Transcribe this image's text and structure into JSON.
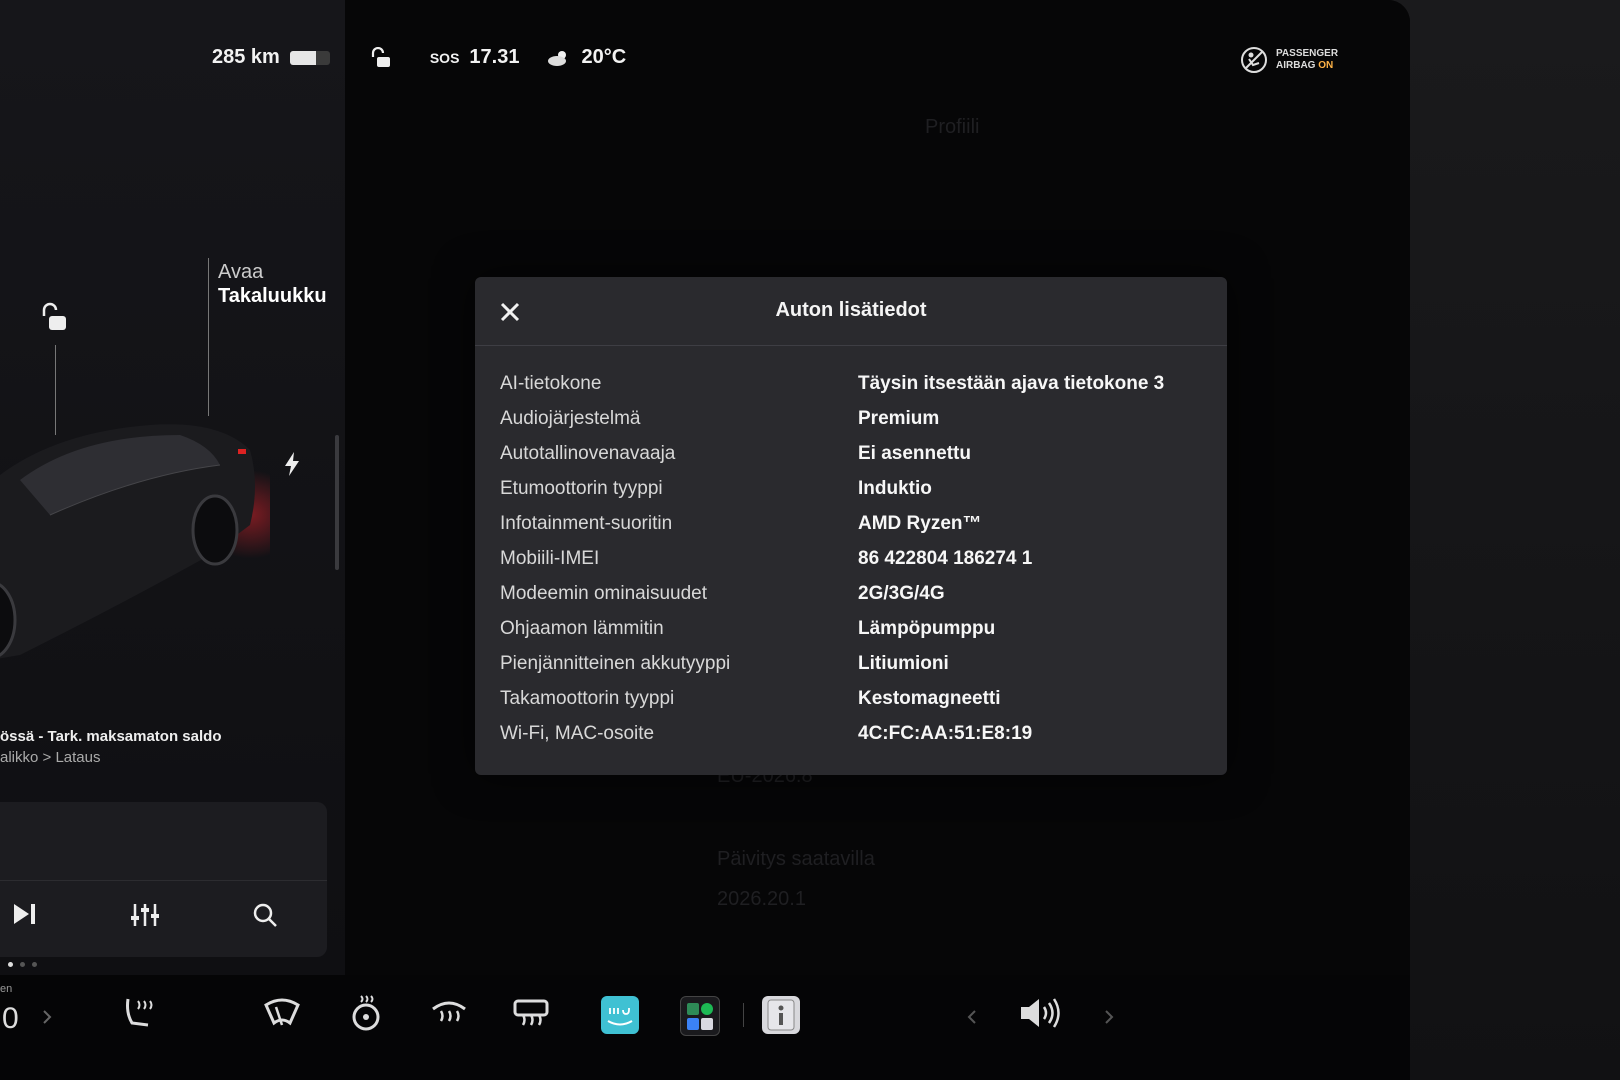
{
  "status": {
    "range": "285 km",
    "battery_level": 0.65,
    "sos": "SOS",
    "time": "17.31",
    "outside_temp": "20°C",
    "airbag_line1": "PASSENGER",
    "airbag_line2": "AIRBAG",
    "airbag_state": "ON"
  },
  "car": {
    "trunk_action": "Avaa",
    "trunk_label": "Takaluukku",
    "notice_line1": "össä - Tark. maksamaton saldo",
    "notice_line2": "alikko > Lataus"
  },
  "background": {
    "profile": "Profiili",
    "version": "EU-2026.8",
    "update_label": "Päivitys saatavilla",
    "update_version": "2026.20.1"
  },
  "bottom_bar": {
    "temp_left": "0",
    "temp_side_label": "en"
  },
  "modal": {
    "title": "Auton lisätiedot",
    "rows": [
      {
        "label": "AI-tietokone",
        "value": "Täysin itsestään ajava tietokone 3"
      },
      {
        "label": "Audiojärjestelmä",
        "value": "Premium"
      },
      {
        "label": "Autotallinovenavaaja",
        "value": "Ei asennettu"
      },
      {
        "label": "Etumoottorin tyyppi",
        "value": "Induktio"
      },
      {
        "label": "Infotainment-suoritin",
        "value": "AMD Ryzen™"
      },
      {
        "label": "Mobiili-IMEI",
        "value": "86 422804 186274 1"
      },
      {
        "label": "Modeemin ominaisuudet",
        "value": "2G/3G/4G"
      },
      {
        "label": "Ohjaamon lämmitin",
        "value": "Lämpöpumppu"
      },
      {
        "label": "Pienjännitteinen akkutyyppi",
        "value": "Litiumioni"
      },
      {
        "label": "Takamoottorin tyyppi",
        "value": "Kestomagneetti"
      },
      {
        "label": "Wi-Fi, MAC-osoite",
        "value": "4C:FC:AA:51:E8:19"
      }
    ]
  },
  "colors": {
    "modal_bg": "#2a2a2e",
    "airbag_on": "#ffb347",
    "amazon_music": "#3fc1d3"
  }
}
